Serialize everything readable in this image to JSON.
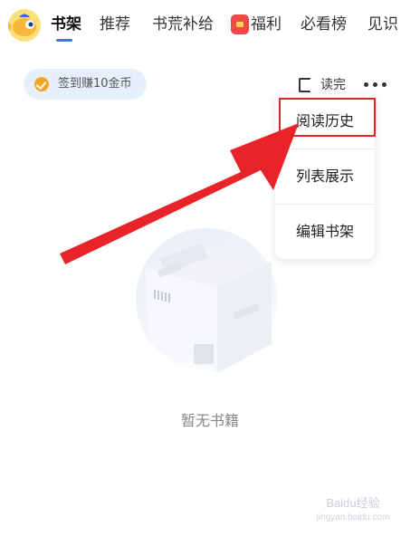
{
  "nav": {
    "tabs": [
      {
        "label": "书架",
        "active": true
      },
      {
        "label": "推荐"
      },
      {
        "label": "书荒补给"
      },
      {
        "label": "福利",
        "icon": "red-envelope-icon"
      },
      {
        "label": "必看榜"
      },
      {
        "label": "见识"
      }
    ],
    "accent": "#2f7cf6"
  },
  "signin": {
    "label": "签到赚10金币"
  },
  "toolbar": {
    "read_done_label": "读完"
  },
  "menu": {
    "items": [
      {
        "label": "阅读历史",
        "highlighted": true
      },
      {
        "label": "列表展示"
      },
      {
        "label": "编辑书架"
      }
    ]
  },
  "empty": {
    "label": "暂无书籍"
  },
  "annotation": {
    "arrow_color": "#e8242a",
    "box_color": "#e02525"
  },
  "watermark": {
    "text": "Baidu经验",
    "sub": "jingyan.baidu.com"
  }
}
